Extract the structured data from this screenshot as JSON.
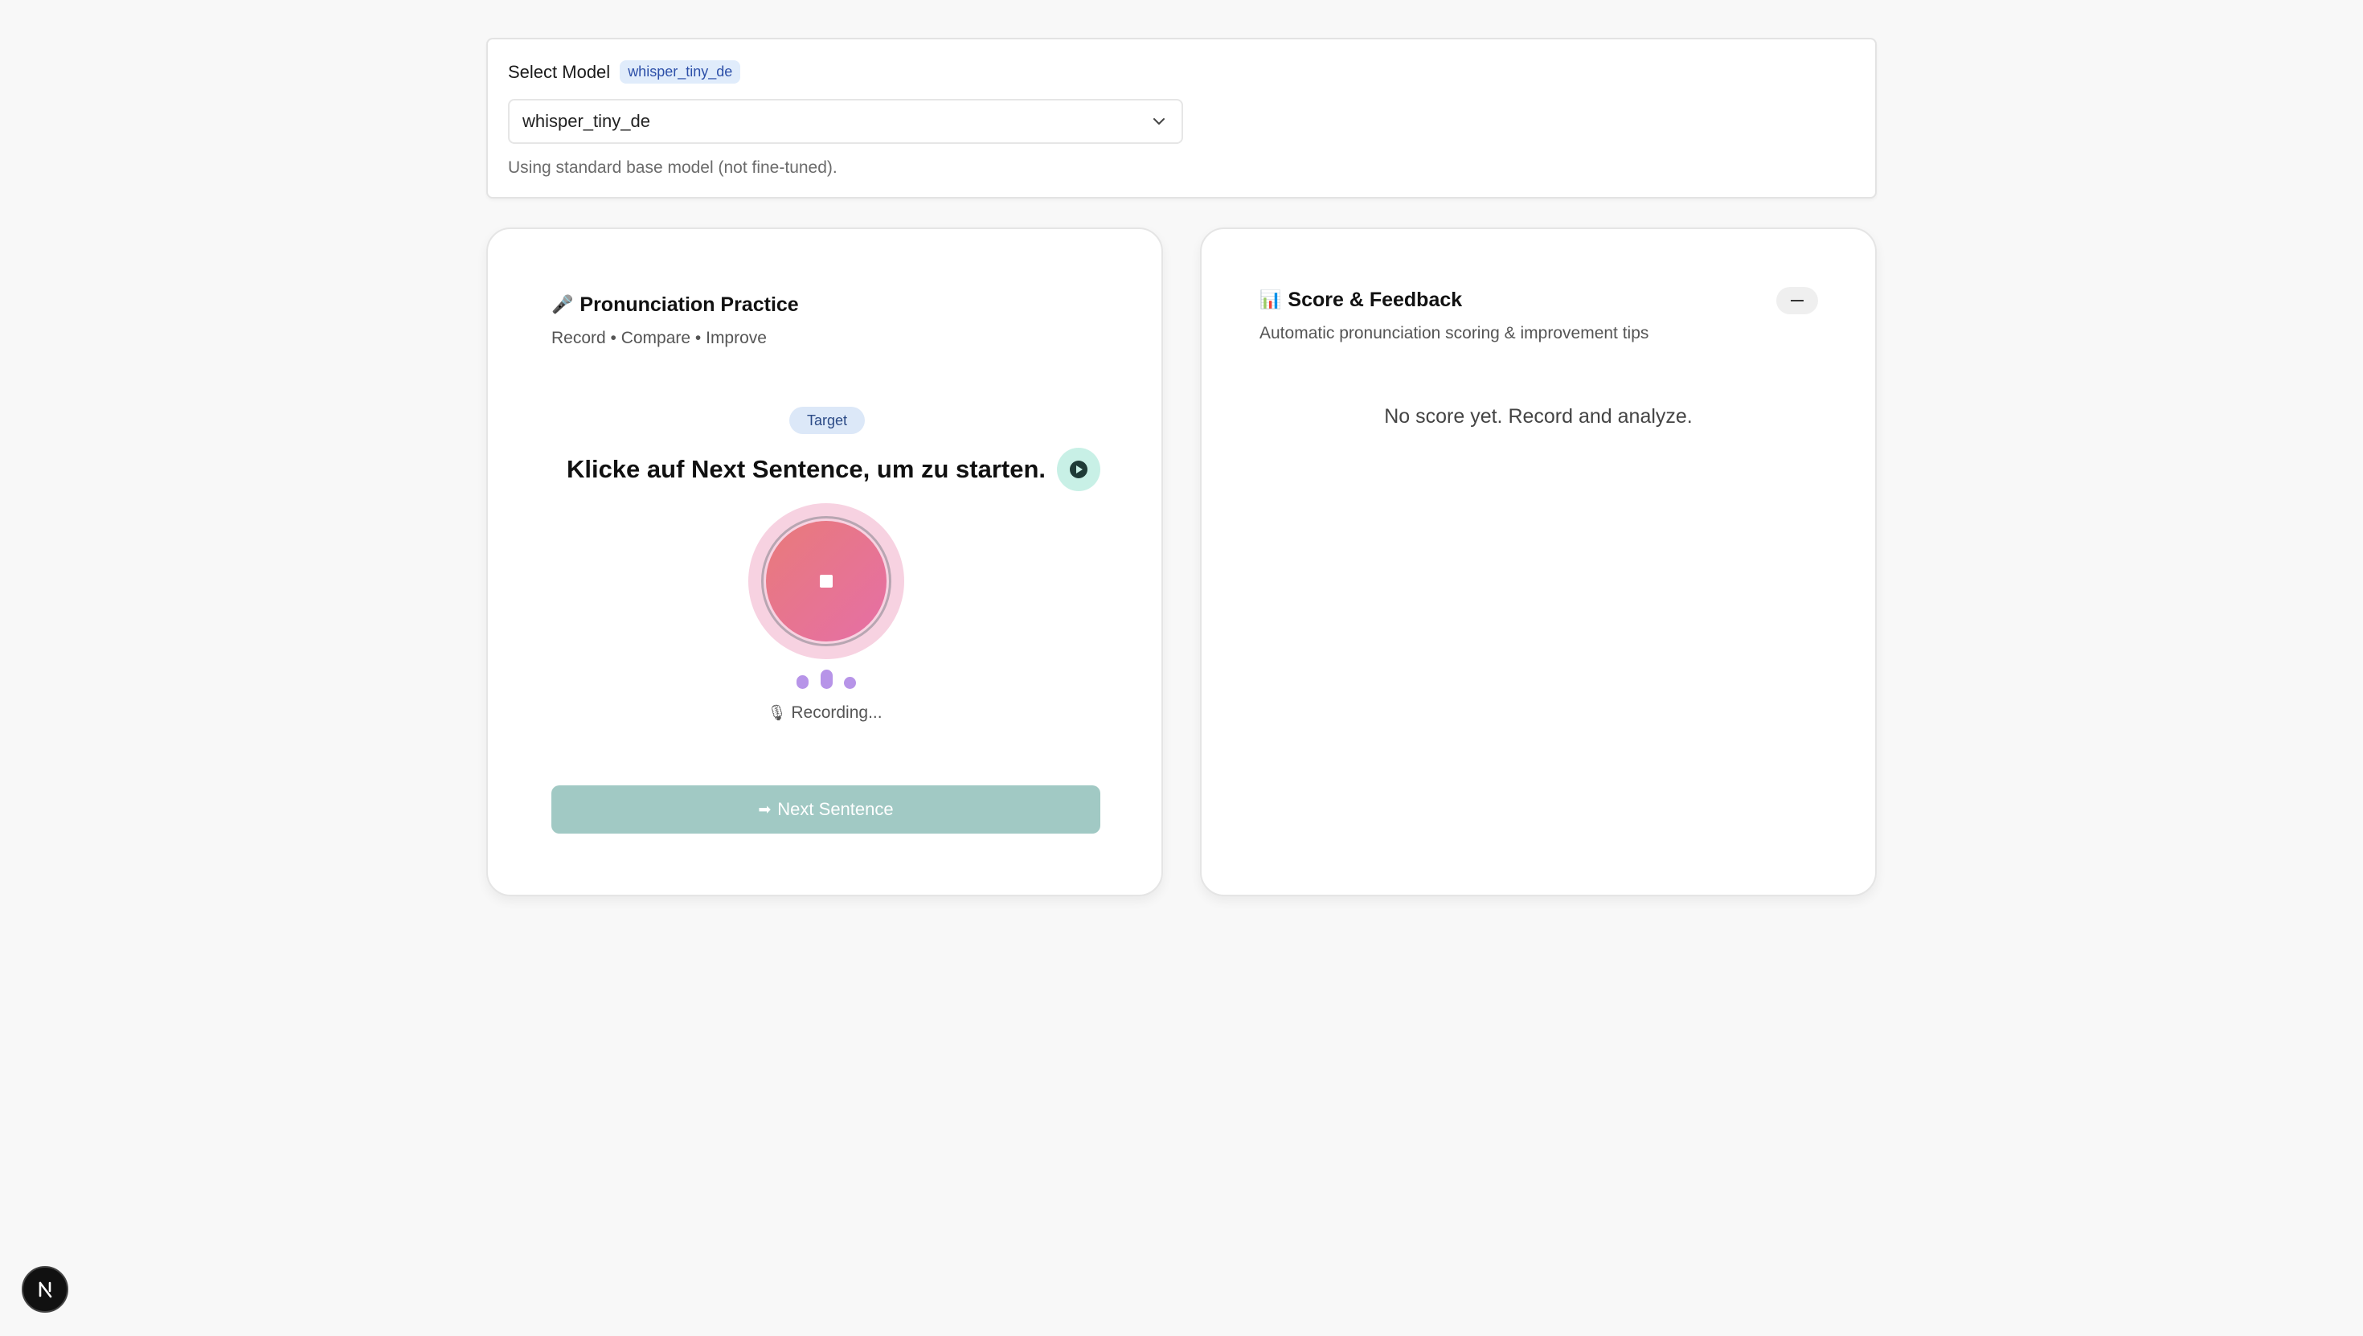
{
  "model_selector": {
    "label": "Select Model",
    "badge": "whisper_tiny_de",
    "selected_value": "whisper_tiny_de",
    "hint": "Using standard base model (not fine-tuned)."
  },
  "practice_card": {
    "title_icon": "🎤",
    "title": "Pronunciation Practice",
    "subtitle": "Record • Compare • Improve",
    "target_label": "Target",
    "target_sentence": "Klicke auf Next Sentence, um zu starten.",
    "status_icon": "🎙",
    "status_text": "Recording...",
    "next_icon": "➡",
    "next_label": "Next Sentence"
  },
  "score_card": {
    "title_icon": "📊",
    "title": "Score & Feedback",
    "subtitle": "Automatic pronunciation scoring & improvement tips",
    "empty_text": "No score yet. Record and analyze."
  },
  "badge": {
    "icon": "nextjs-logo-icon",
    "letter": "N"
  },
  "colors": {
    "accent_teal": "#a1c9c4",
    "record_gradient_start": "#e87a7a",
    "record_gradient_end": "#e66fa6",
    "wave_purple": "#b794e8",
    "badge_blue_bg": "#e0ecfb",
    "badge_blue_text": "#2c4fa8"
  }
}
